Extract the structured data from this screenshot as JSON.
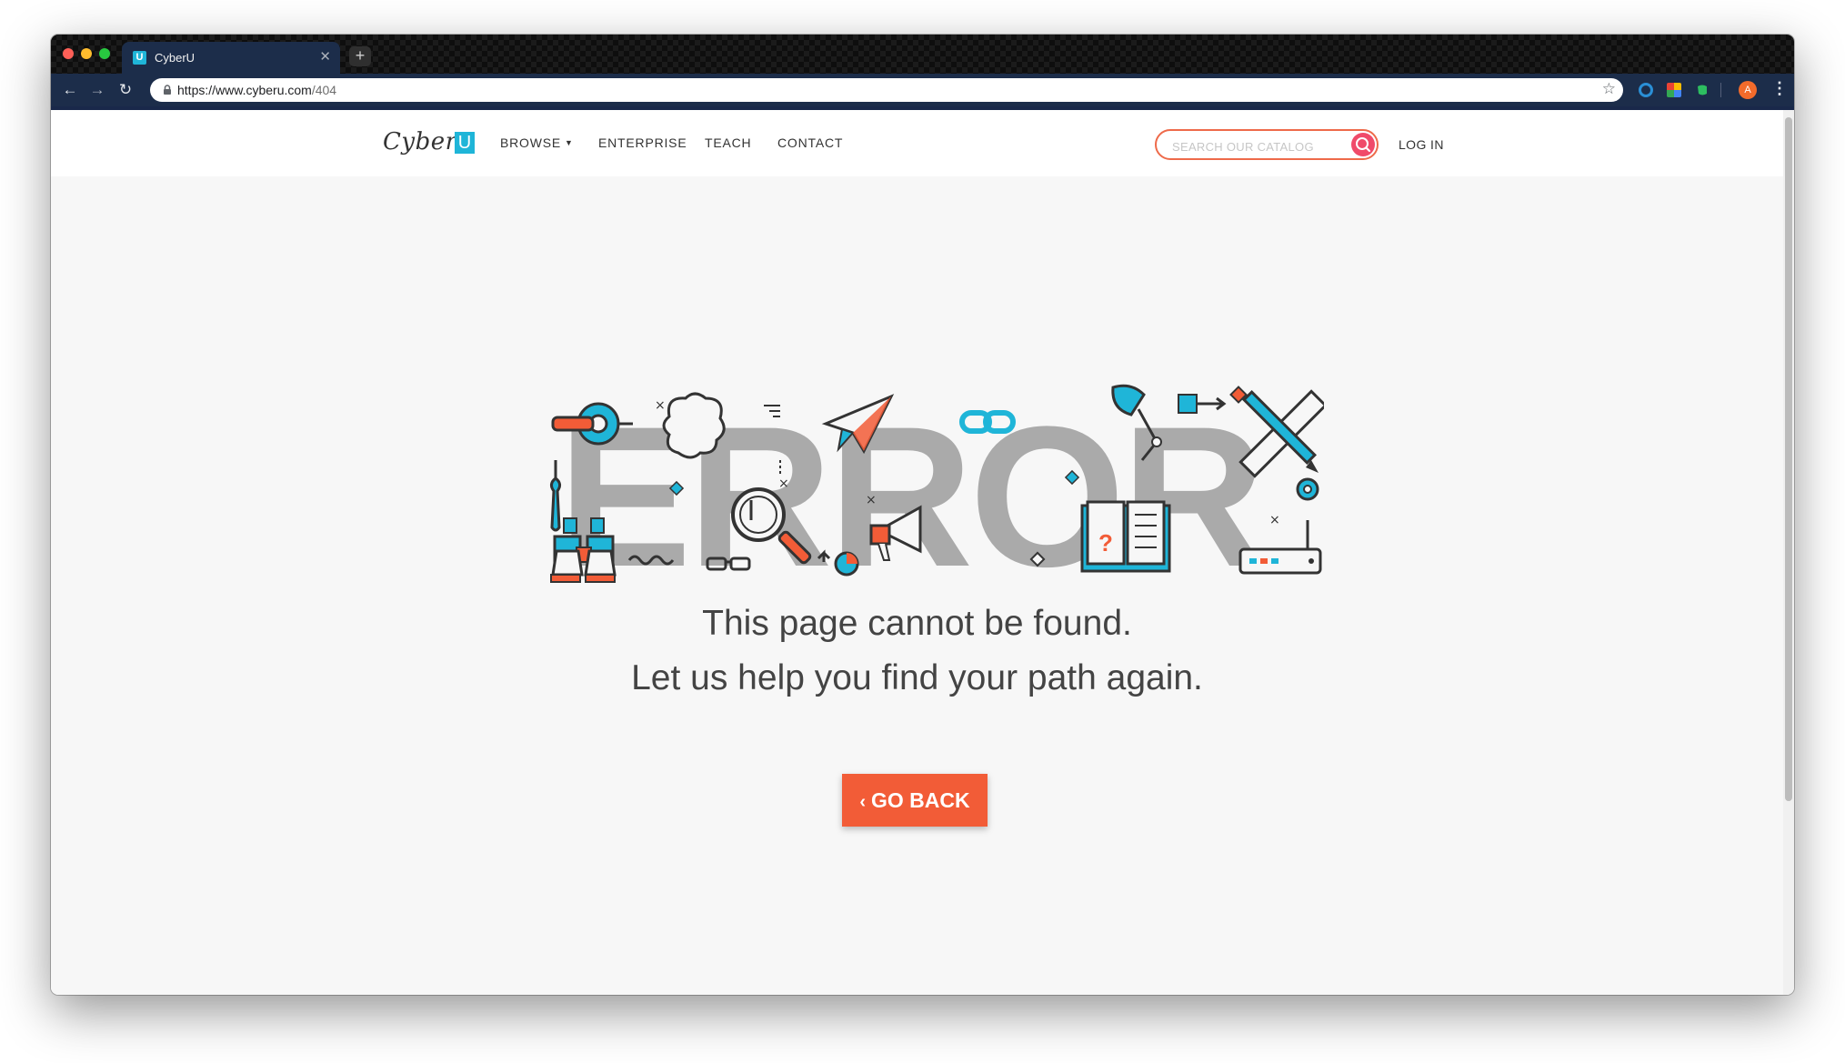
{
  "browser": {
    "tab_title": "CyberU",
    "tab_favicon": "U",
    "url_host": "https://www.cyberu.com",
    "url_path": "/404",
    "profile_initial": "A"
  },
  "site": {
    "logo_text": "Cyber",
    "logo_box": "U",
    "nav": {
      "browse": "BROWSE",
      "enterprise": "ENTERPRISE",
      "teach": "TEACH",
      "contact": "CONTACT"
    },
    "search_placeholder": "SEARCH OUR CATALOG",
    "login": "LOG IN"
  },
  "error": {
    "big_word": "ERROR",
    "line1": "This page cannot be found.",
    "line2": "Let us help you find your path again.",
    "button_label": "GO BACK"
  },
  "colors": {
    "accent": "#f25c37",
    "teal": "#1fb5d8",
    "error_gray": "#aaaaaa"
  }
}
